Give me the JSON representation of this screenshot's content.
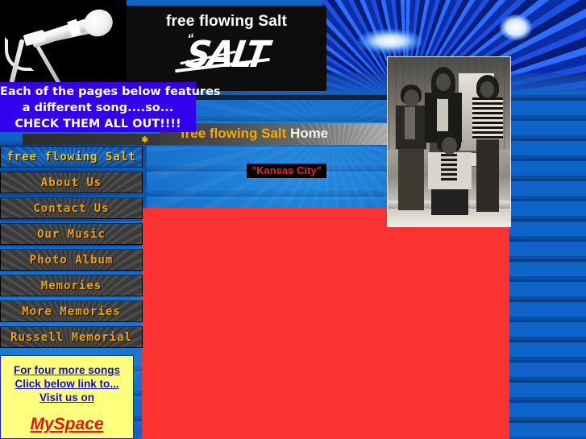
{
  "site": {
    "band_name": "free flowing Salt",
    "logo_title": "free flowing Salt",
    "logo_mark": "SALT",
    "logo_mark_quotes": "“"
  },
  "announcement": {
    "line1": "Each of the pages below features",
    "line2": "a different song....so...",
    "line3": "CHECK THEM ALL OUT!!!!"
  },
  "title_banner": {
    "name_part": "free flowing Salt",
    "page_part": " Home",
    "star_glyph": "✱"
  },
  "now_playing": {
    "song_label": "\"Kansas City\""
  },
  "nav": {
    "items": [
      {
        "label": "free flowing Salt",
        "active": true
      },
      {
        "label": "About Us",
        "active": false
      },
      {
        "label": "Contact Us",
        "active": false
      },
      {
        "label": "Our Music",
        "active": false
      },
      {
        "label": "Photo Album",
        "active": false
      },
      {
        "label": "Memories",
        "active": false
      },
      {
        "label": "More Memories",
        "active": false
      },
      {
        "label": "Russell Memorial",
        "active": false
      }
    ]
  },
  "myspace_box": {
    "line1": "For four more songs",
    "line2": "Click below link to...",
    "line3": "Visit us on",
    "link_label": "MySpace"
  },
  "media": {
    "placeholder_note": ""
  },
  "colors": {
    "page_blue": "#0b57b8",
    "announce_blue": "#3300ee",
    "nav_gold": "#f0a500",
    "nav_active_blue": "#1162c4",
    "song_red": "#ee2222",
    "media_red": "#fa3232",
    "myspace_yellow": "#ffff7e",
    "myspace_link_red": "#ee1111",
    "myspace_text_blue": "#1111cc",
    "banner_gold": "#f5a800",
    "banner_cream": "#f7f2e2"
  }
}
